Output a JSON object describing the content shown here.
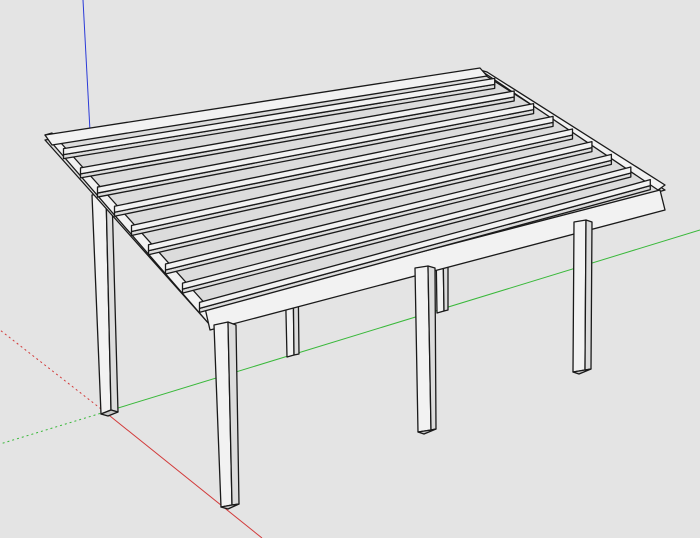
{
  "viewport": {
    "background": "#e4e4e4",
    "axis_colors": {
      "red": "#d23a3a",
      "green": "#39b83a",
      "blue": "#2b3bd8"
    }
  },
  "model": {
    "description_icon": "pergola-icon",
    "posts": 6,
    "rafters": 9
  }
}
